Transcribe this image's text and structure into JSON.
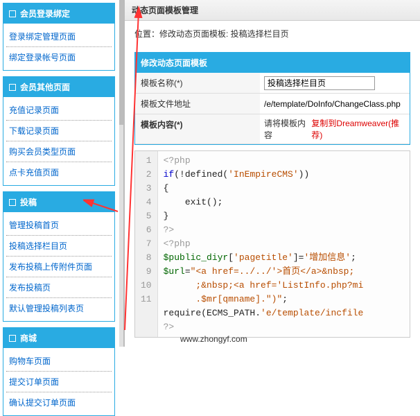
{
  "sidebar": {
    "panels": [
      {
        "title": "会员登录绑定",
        "items": [
          "登录绑定管理页面",
          "绑定登录帐号页面"
        ]
      },
      {
        "title": "会员其他页面",
        "items": [
          "充值记录页面",
          "下载记录页面",
          "购买会员类型页面",
          "点卡充值页面"
        ]
      },
      {
        "title": "投稿",
        "items": [
          "管理投稿首页",
          "投稿选择栏目页",
          "发布投稿上传附件页面",
          "发布投稿页",
          "默认管理投稿列表页"
        ]
      },
      {
        "title": "商城",
        "items": [
          "购物车页面",
          "提交订单页面",
          "确认提交订单页面"
        ]
      }
    ]
  },
  "main": {
    "title": "动态页面模板管理",
    "breadcrumb": "位置：修改动态页面模板: 投稿选择栏目页",
    "form": {
      "header": "修改动态页面模板",
      "name_label": "模板名称(*)",
      "name_value": "投稿选择栏目页",
      "file_label": "模板文件地址",
      "file_value": "/e/template/DoInfo/ChangeClass.php",
      "content_label": "模板内容(*)",
      "content_hint_prefix": "请将模板内容",
      "content_hint_hl": "复制到Dreamweaver(推荐)"
    },
    "code_lines": [
      {
        "n": "1",
        "html": "<span class='c-php'>&lt;?php</span>"
      },
      {
        "n": "2",
        "html": "<span class='c-kw'>if</span>(!defined(<span class='c-str'>'InEmpireCMS'</span>))"
      },
      {
        "n": "3",
        "html": "{"
      },
      {
        "n": "4",
        "html": "    exit();"
      },
      {
        "n": "5",
        "html": "}"
      },
      {
        "n": "6",
        "html": "<span class='c-php'>?&gt;</span>"
      },
      {
        "n": "7",
        "html": "<span class='c-php'>&lt;?php</span>"
      },
      {
        "n": "8",
        "html": "<span class='c-var'>$public_diyr</span>[<span class='c-str'>'pagetitle'</span>]=<span class='c-str'>'增加信息'</span>;"
      },
      {
        "n": "9",
        "html": "<span class='c-var'>$url</span>=<span class='c-str'>\"&lt;a href=../../'&gt;首页&lt;/a&gt;&amp;nbsp;</span><br>      <span class='c-str'>;&amp;nbsp;&lt;a href='ListInfo.php?mi</span><br>      <span class='c-str'>.$mr[qmname].\")\"</span>;"
      },
      {
        "n": "10",
        "html": "require(ECMS_PATH.<span class='c-str'>'e/template/incfile</span>"
      },
      {
        "n": "11",
        "html": "<span class='c-php'>?&gt;</span>"
      }
    ]
  },
  "footer": "www.zhongyf.com"
}
